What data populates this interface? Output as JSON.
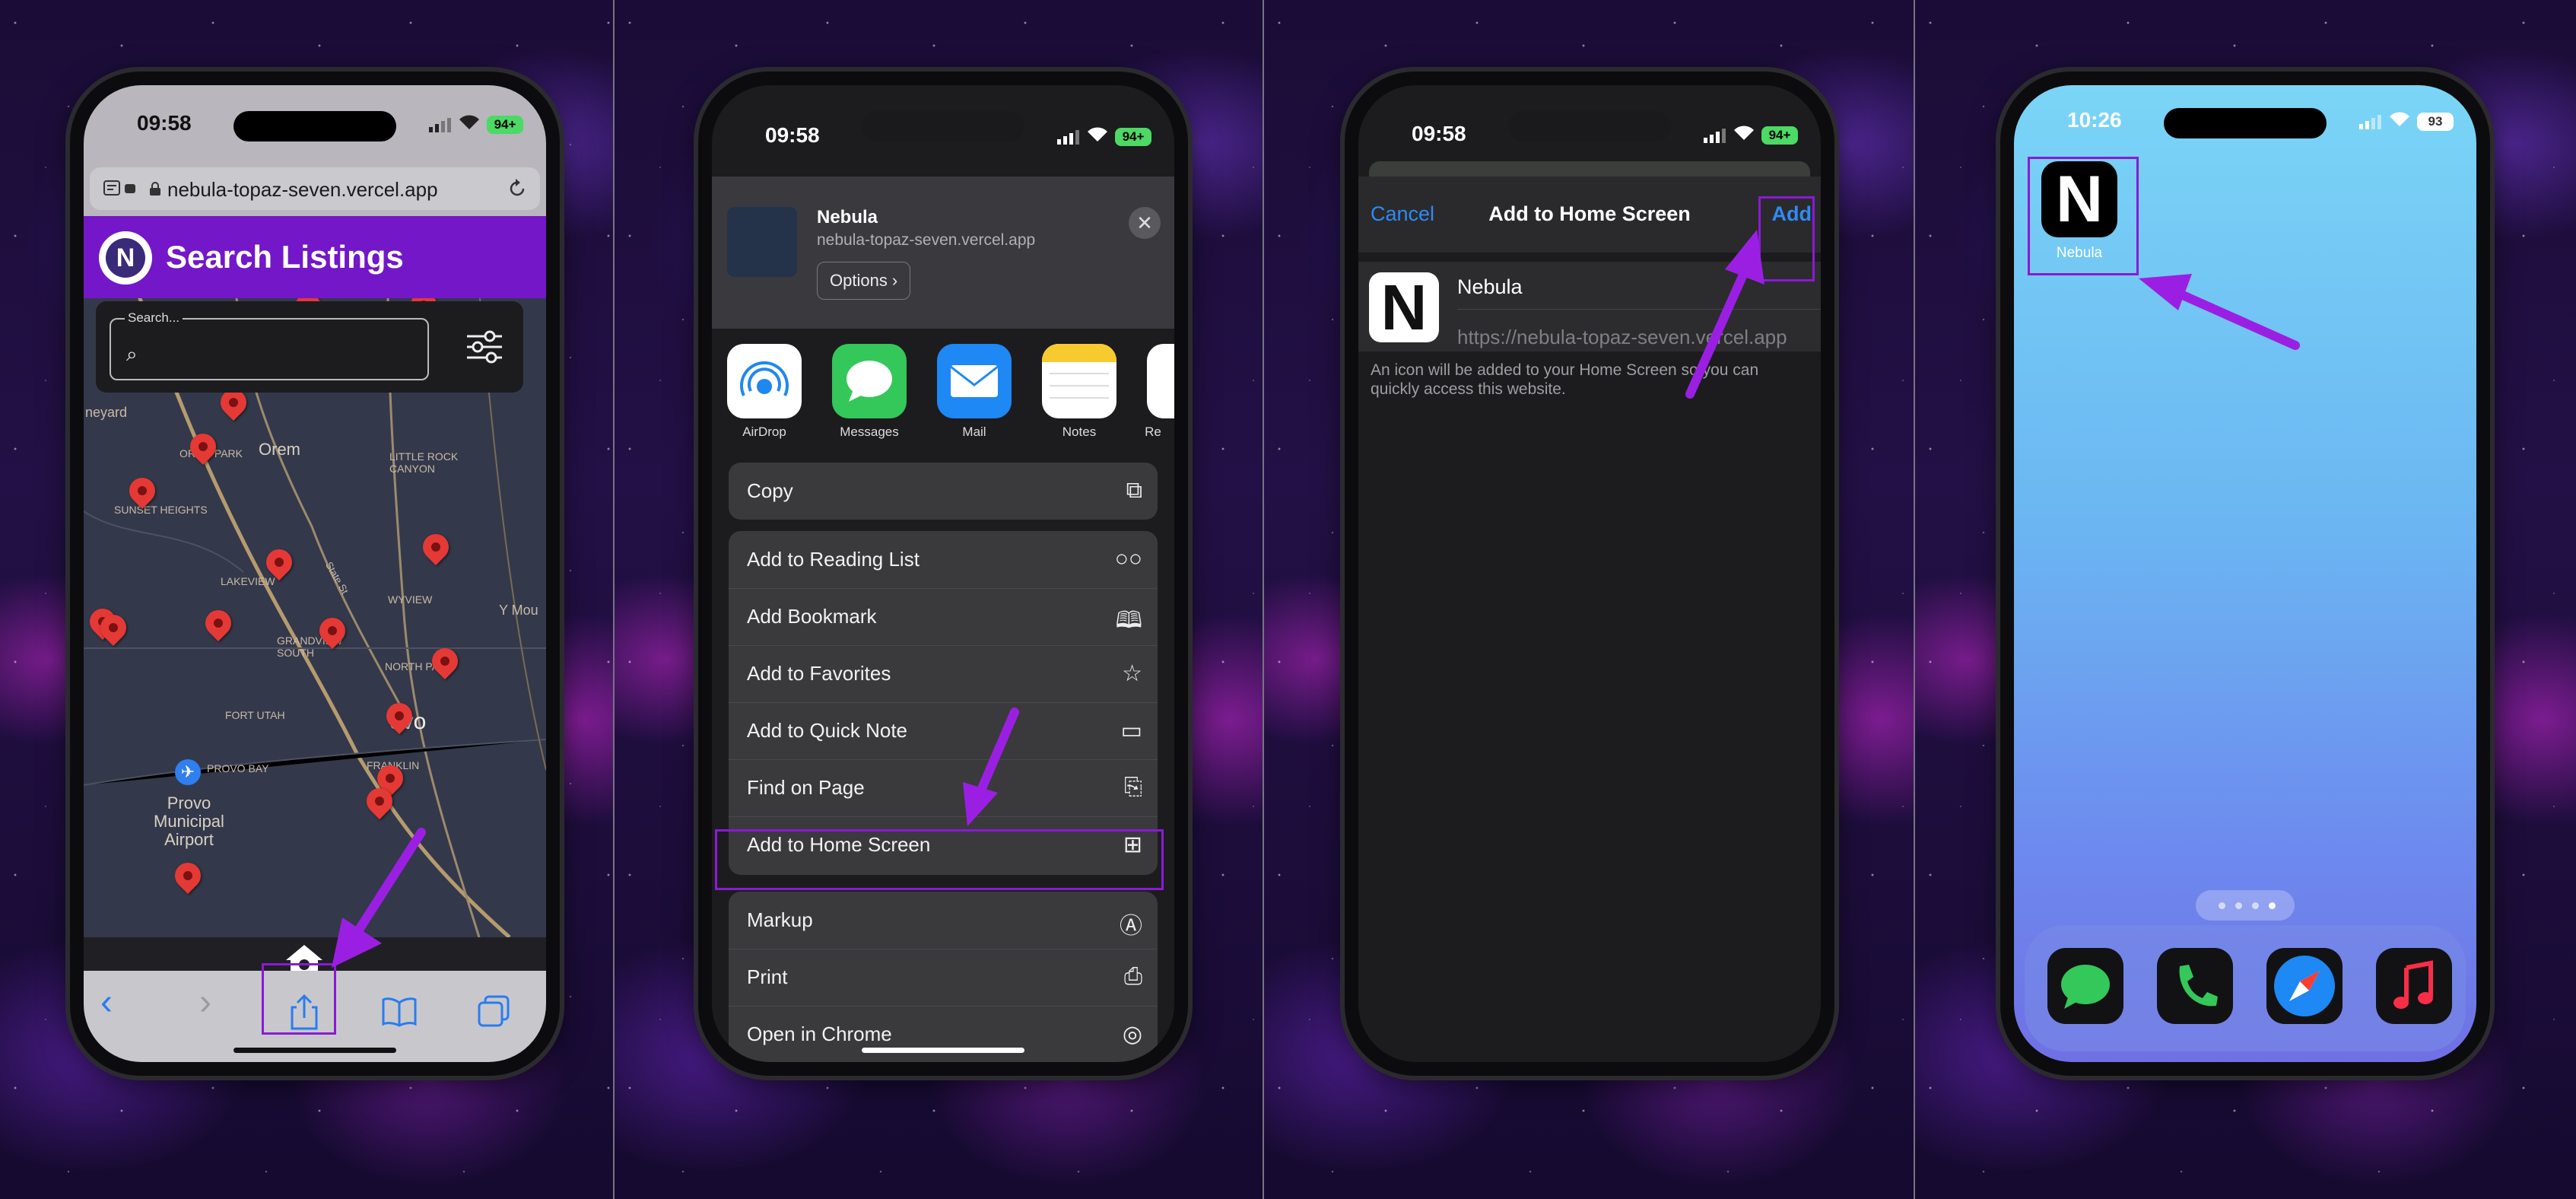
{
  "panel1": {
    "status": {
      "time": "09:58",
      "battery": "94+"
    },
    "url": "nebula-topaz-seven.vercel.app",
    "header": {
      "logo": "N",
      "title": "Search Listings"
    },
    "search": {
      "label": "Search..."
    },
    "map_labels": {
      "orem": "Orem",
      "provo": "Provo\nMunicipal\nAirport",
      "ovo": "ovo",
      "sunset": "SUNSET HEIGHTS",
      "lakeview": "LAKEVIEW",
      "grandview": "GRANDVIEW\nSOUTH",
      "northpark": "NORTH PARK",
      "fortutah": "FORT UTAH",
      "provobay": "PROVO BAY",
      "franklin": "FRANKLIN",
      "littlerock": "LITTLE ROCK\nCANYON",
      "vineyard": "neyard",
      "yvmou": "Y Mou",
      "oremPark": "OREM PARK",
      "wyview": "WYVIEW",
      "state": "State St"
    },
    "toolbar": {
      "back": "‹",
      "forward": "›"
    }
  },
  "panel2": {
    "status": {
      "time": "09:58",
      "battery": "94+"
    },
    "app_name": "Nebula",
    "app_url": "nebula-topaz-seven.vercel.app",
    "options": "Options ›",
    "close": "✕",
    "apps": [
      {
        "label": "AirDrop",
        "color": "#ffffff"
      },
      {
        "label": "Messages",
        "color": "#34c759"
      },
      {
        "label": "Mail",
        "color": "#1e88f5"
      },
      {
        "label": "Notes",
        "color": "#ffffff"
      },
      {
        "label": "Re",
        "color": "#ffffff"
      }
    ],
    "actions": {
      "copy": "Copy",
      "reading_list": "Add to Reading List",
      "bookmark": "Add Bookmark",
      "favorites": "Add to Favorites",
      "quick_note": "Add to Quick Note",
      "find": "Find on Page",
      "home_screen": "Add to Home Screen",
      "markup": "Markup",
      "print": "Print",
      "chrome": "Open in Chrome"
    }
  },
  "panel3": {
    "status": {
      "time": "09:58",
      "battery": "94+"
    },
    "cancel": "Cancel",
    "title": "Add to Home Screen",
    "add": "Add",
    "name": "Nebula",
    "url": "https://nebula-topaz-seven.vercel.app",
    "note": "An icon will be added to your Home Screen so you can quickly access this website."
  },
  "panel4": {
    "status": {
      "time": "10:26",
      "battery": "93"
    },
    "app_label": "Nebula",
    "dock": [
      {
        "name": "Messages",
        "color": "#34c759"
      },
      {
        "name": "Phone",
        "color": "#34c759"
      },
      {
        "name": "Safari",
        "color": "#1e88f5"
      },
      {
        "name": "Music",
        "color": "#fa2d48"
      }
    ]
  },
  "colors": {
    "highlight": "#8b19d6",
    "ios_blue": "#2f8af5",
    "header_purple": "#7317c9"
  }
}
